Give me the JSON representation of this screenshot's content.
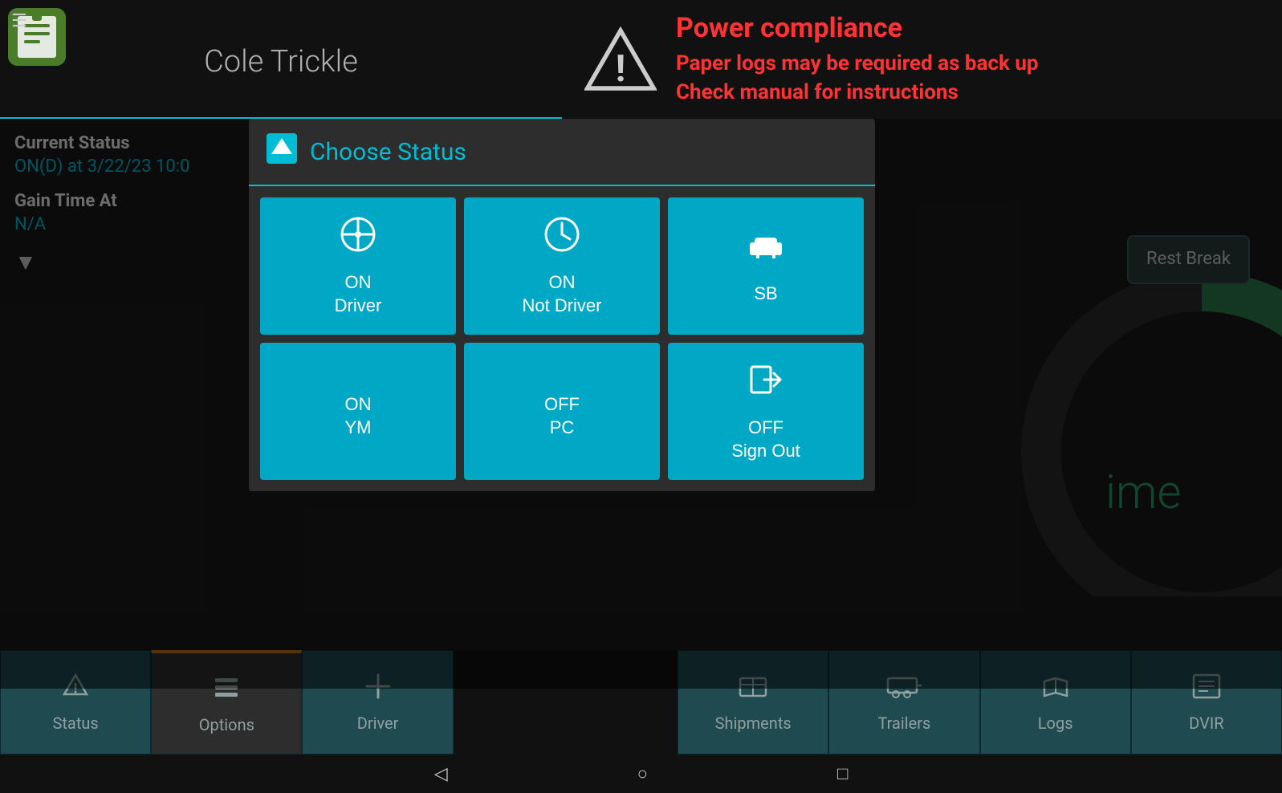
{
  "header": {
    "driver_name": "Cole Trickle",
    "menu_icon": "☰",
    "warning_title": "Power compliance",
    "warning_line1": "Paper logs may be required as back up",
    "warning_line2": "Check manual for instructions"
  },
  "left_panel": {
    "current_status_label": "Current Status",
    "current_status_value": "ON(D) at 3/22/23 10:0",
    "gain_time_label": "Gain Time At",
    "gain_time_value": "N/A"
  },
  "dialog": {
    "title": "Choose Status",
    "buttons": [
      {
        "id": "on-driver",
        "icon": "steering",
        "label": "ON\nDriver"
      },
      {
        "id": "on-not-driver",
        "icon": "clock",
        "label": "ON\nNot Driver"
      },
      {
        "id": "sb",
        "icon": "sofa",
        "label": "SB"
      },
      {
        "id": "on-ym",
        "icon": "",
        "label": "ON\nYM"
      },
      {
        "id": "off-pc",
        "icon": "",
        "label": "OFF\nPC"
      },
      {
        "id": "off-sign-out",
        "icon": "sign-out",
        "label": "OFF\nSign Out"
      }
    ]
  },
  "gauge": {
    "time_text": "ime"
  },
  "rest_break": {
    "label": "Rest\nBreak"
  },
  "bottom_nav": {
    "items": [
      {
        "id": "status",
        "icon": "nav",
        "label": "Status"
      },
      {
        "id": "options",
        "icon": "options",
        "label": "Options"
      },
      {
        "id": "driver",
        "icon": "plus",
        "label": "Driver"
      },
      {
        "id": "shipments",
        "icon": "shipments",
        "label": "Shipments"
      },
      {
        "id": "trailers",
        "icon": "trailers",
        "label": "Trailers"
      },
      {
        "id": "logs",
        "icon": "logs",
        "label": "Logs"
      },
      {
        "id": "dvir",
        "icon": "dvir",
        "label": "DVIR"
      }
    ]
  },
  "sys_nav": {
    "back": "◁",
    "home": "○",
    "recent": "□"
  },
  "colors": {
    "accent": "#00bcd4",
    "warning_red": "#ff3333",
    "status_teal": "#1e4a50",
    "btn_teal": "#00a8c6"
  }
}
